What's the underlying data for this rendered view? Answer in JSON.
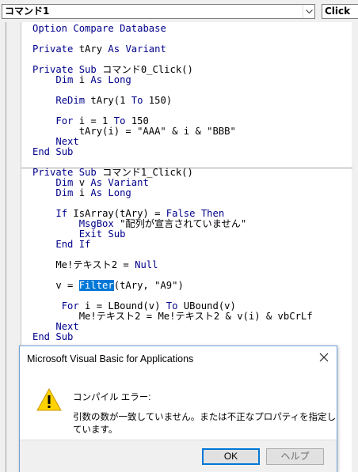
{
  "top": {
    "object_combo": "コマンド1",
    "proc_combo": "Click"
  },
  "code_lines": [
    "Option Compare Database",
    "",
    "Private tAry As Variant",
    "",
    "Private Sub コマンド0_Click()",
    "    Dim i As Long",
    "",
    "    ReDim tAry(1 To 150)",
    "",
    "    For i = 1 To 150",
    "        tAry(i) = \"AAA\" & i & \"BBB\"",
    "    Next",
    "End Sub",
    "",
    "Private Sub コマンド1_Click()",
    "    Dim v As Variant",
    "    Dim i As Long",
    "",
    "    If IsArray(tAry) = False Then",
    "        MsgBox \"配列が宣言されていません\"",
    "        Exit Sub",
    "    End If",
    "",
    "    Me!テキスト2 = Null",
    "",
    "    v = Filter(tAry, \"A9\")",
    "",
    "     For i = LBound(v) To UBound(v)",
    "        Me!テキスト2 = Me!テキスト2 & v(i) & vbCrLf",
    "    Next",
    "End Sub"
  ],
  "selected_word": "Filter",
  "dialog": {
    "title": "Microsoft Visual Basic for Applications",
    "header": "コンパイル エラー:",
    "message": "引数の数が一致していません。または不正なプロパティを指定しています。",
    "ok_label": "OK",
    "help_label": "ヘルプ",
    "icon": "warning-icon"
  },
  "colors": {
    "keyword": "#00008b",
    "selection": "#0078d7",
    "dialog_border": "#6f9fd8"
  }
}
